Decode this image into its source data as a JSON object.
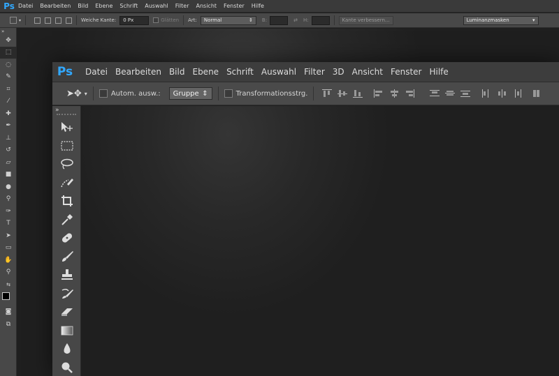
{
  "app": {
    "logo": "Ps"
  },
  "menu": [
    "Datei",
    "Bearbeiten",
    "Bild",
    "Ebene",
    "Schrift",
    "Auswahl",
    "Filter",
    "3D",
    "Ansicht",
    "Fenster",
    "Hilfe"
  ],
  "small_menu": [
    "Datei",
    "Bearbeiten",
    "Bild",
    "Ebene",
    "Schrift",
    "Auswahl",
    "Filter",
    "Ansicht",
    "Fenster",
    "Hilfe"
  ],
  "marquee_options": {
    "feather_label": "Weiche Kante:",
    "feather_value": "0 Px",
    "antialias_label": "Glätten",
    "style_label": "Art:",
    "style_value": "Normal",
    "width_label": "B:",
    "height_label": "H:",
    "refine_edge_button": "Kante verbessern...",
    "workspace_value": "Luminanzmasken"
  },
  "move_options": {
    "auto_select_label": "Autom. ausw.:",
    "auto_select_target": "Gruppe",
    "transform_controls_label": "Transformationsstrg."
  },
  "toolbar": {
    "collapse_glyph": "»"
  },
  "colors": {
    "ps_blue": "#31a8ff",
    "menubar": "#3d3d3d",
    "panel": "#4a4a4a",
    "canvas": "#1f1f1f"
  }
}
